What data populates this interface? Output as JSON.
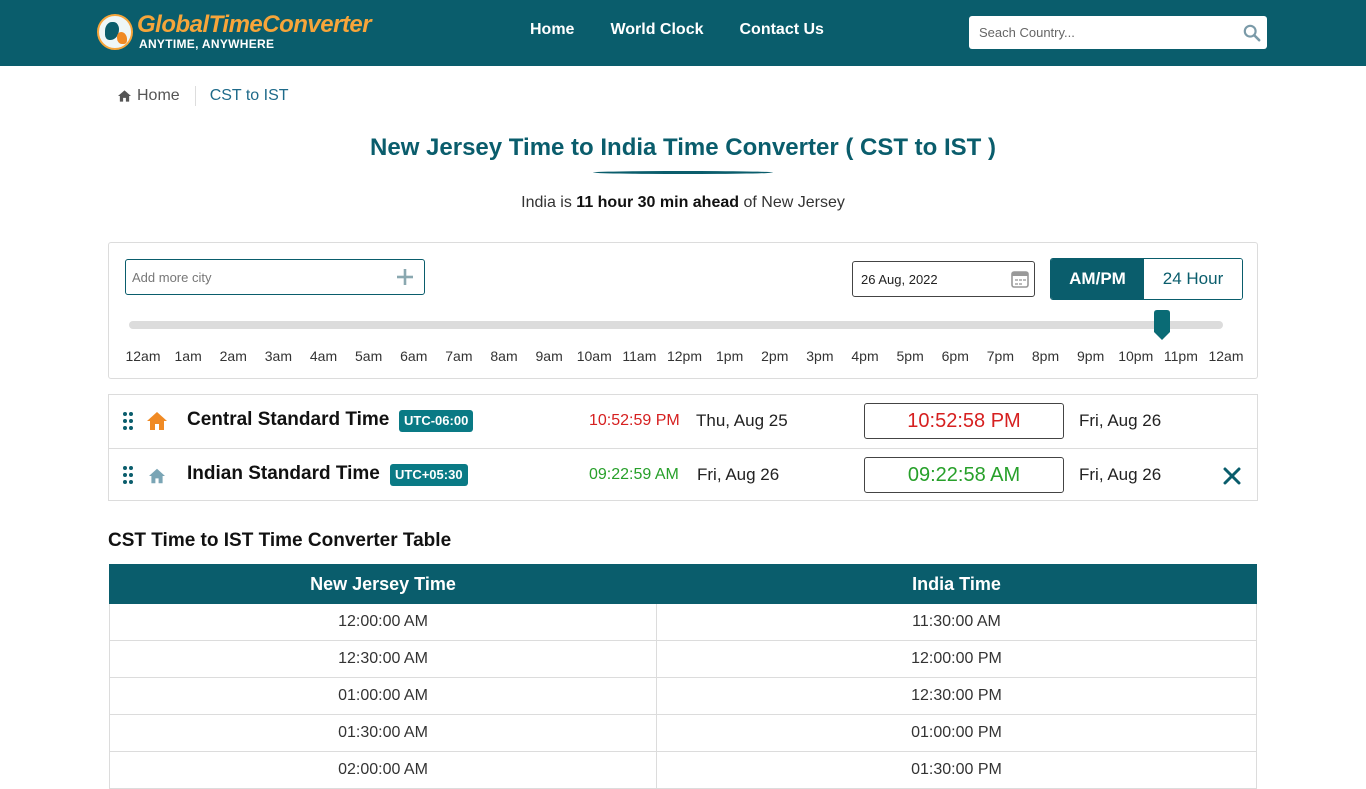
{
  "brand": {
    "name": "GlobalTimeConverter",
    "tagline": "ANYTIME, ANYWHERE",
    "primary_color": "#0a5d6c",
    "accent_color": "#f6a53a"
  },
  "nav": {
    "items": [
      "Home",
      "World Clock",
      "Contact Us"
    ]
  },
  "search": {
    "placeholder": "Seach Country..."
  },
  "breadcrumb": {
    "home": "Home",
    "current": "CST to IST"
  },
  "page": {
    "title": "New Jersey Time to India Time Converter ( CST to IST )",
    "subtitle_prefix": "India is ",
    "subtitle_bold": "11 hour 30 min ahead",
    "subtitle_suffix": " of New Jersey"
  },
  "controls": {
    "add_city_placeholder": "Add more city",
    "date": "26 Aug, 2022",
    "format_ampm": "AM/PM",
    "format_24": "24 Hour",
    "selected_format": "AM/PM",
    "slider_fraction": 0.944
  },
  "hours": [
    "12am",
    "1am",
    "2am",
    "3am",
    "4am",
    "5am",
    "6am",
    "7am",
    "8am",
    "9am",
    "10am",
    "11am",
    "12pm",
    "1pm",
    "2pm",
    "3pm",
    "4pm",
    "5pm",
    "6pm",
    "7pm",
    "8pm",
    "9pm",
    "10pm",
    "11pm",
    "12am"
  ],
  "zones": [
    {
      "name": "Central Standard Time",
      "utc": "UTC-06:00",
      "live_time": "10:52:59 PM",
      "live_date": "Thu, Aug 25",
      "converted_time": "10:52:58 PM",
      "converted_date": "Fri, Aug 26",
      "time_color": "#d62020"
    },
    {
      "name": "Indian Standard Time",
      "utc": "UTC+05:30",
      "live_time": "09:22:59 AM",
      "live_date": "Fri, Aug 26",
      "converted_time": "09:22:58 AM",
      "converted_date": "Fri, Aug 26",
      "time_color": "#27a02a"
    }
  ],
  "table": {
    "title": "CST Time to IST Time Converter Table",
    "headers": [
      "New Jersey Time",
      "India Time"
    ],
    "rows": [
      [
        "12:00:00 AM",
        "11:30:00 AM"
      ],
      [
        "12:30:00 AM",
        "12:00:00 PM"
      ],
      [
        "01:00:00 AM",
        "12:30:00 PM"
      ],
      [
        "01:30:00 AM",
        "01:00:00 PM"
      ],
      [
        "02:00:00 AM",
        "01:30:00 PM"
      ]
    ]
  }
}
